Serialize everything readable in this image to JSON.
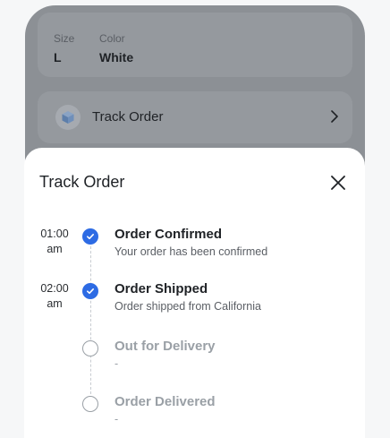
{
  "product": {
    "size_label": "Size",
    "size_value": "L",
    "color_label": "Color",
    "color_value": "White"
  },
  "track_row": {
    "label": "Track Order",
    "icon": "box-icon"
  },
  "sheet": {
    "title": "Track Order",
    "steps": [
      {
        "time": "01:00",
        "ampm": "am",
        "title": "Order Confirmed",
        "subtitle": "Your order has been confirmed",
        "status": "done"
      },
      {
        "time": "02:00",
        "ampm": "am",
        "title": "Order Shipped",
        "subtitle": "Order shipped from California",
        "status": "done"
      },
      {
        "time": "",
        "ampm": "",
        "title": "Out for Delivery",
        "subtitle": "-",
        "status": "pending"
      },
      {
        "time": "",
        "ampm": "",
        "title": "Order Delivered",
        "subtitle": "-",
        "status": "pending"
      }
    ]
  },
  "colors": {
    "accent": "#2d6be4",
    "overlay": "#8c9095",
    "pending": "#9aa0a6"
  }
}
